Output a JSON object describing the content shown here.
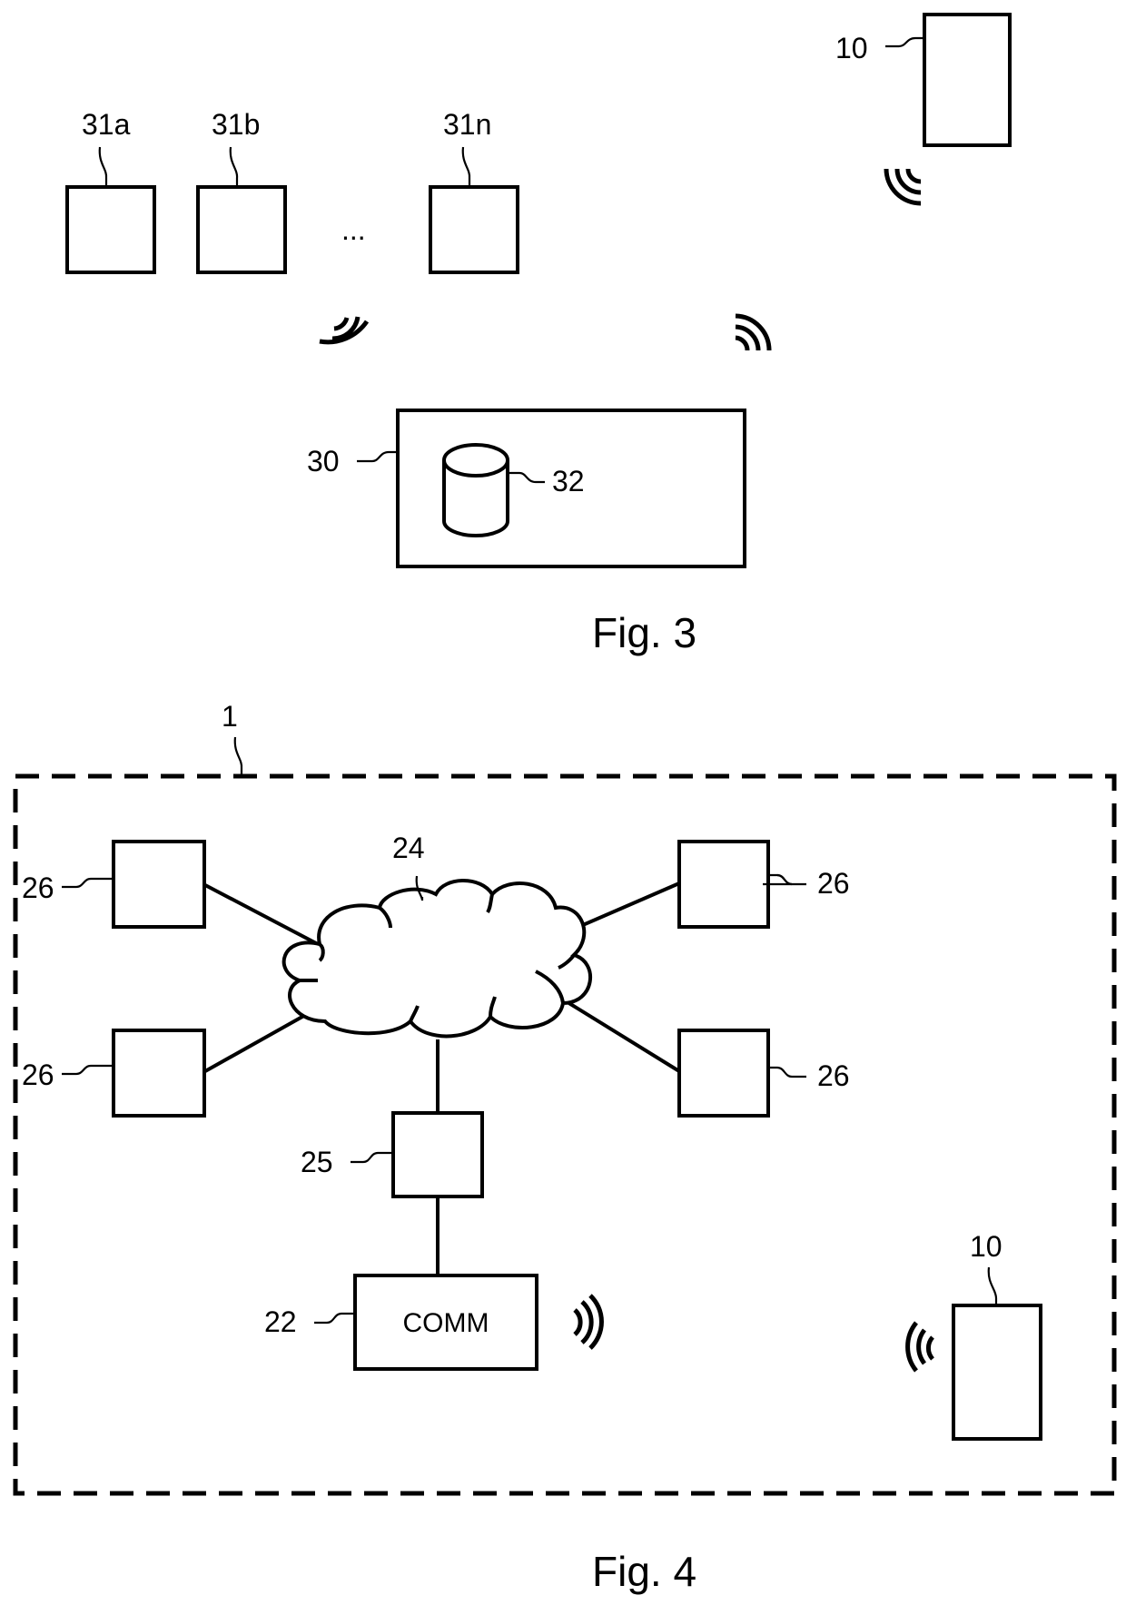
{
  "figure3": {
    "caption": "Fig. 3",
    "devices": [
      {
        "ref": "31a"
      },
      {
        "ref": "31b"
      },
      {
        "ref": "31n"
      }
    ],
    "ellipsis": "...",
    "mobile_device": {
      "ref": "10"
    },
    "server": {
      "ref": "30"
    },
    "database": {
      "ref": "32"
    },
    "signals": [
      "wireless-signal",
      "wireless-signal",
      "wireless-signal"
    ]
  },
  "figure4": {
    "caption": "Fig. 4",
    "boundary": {
      "ref": "1"
    },
    "network": {
      "ref": "24"
    },
    "nodes": [
      {
        "ref": "26"
      },
      {
        "ref": "26"
      },
      {
        "ref": "26"
      },
      {
        "ref": "26"
      }
    ],
    "gateway": {
      "ref": "25"
    },
    "comm_unit": {
      "ref": "22",
      "label": "COMM"
    },
    "mobile_device": {
      "ref": "10"
    },
    "signals": [
      "wireless-signal",
      "wireless-signal"
    ]
  }
}
